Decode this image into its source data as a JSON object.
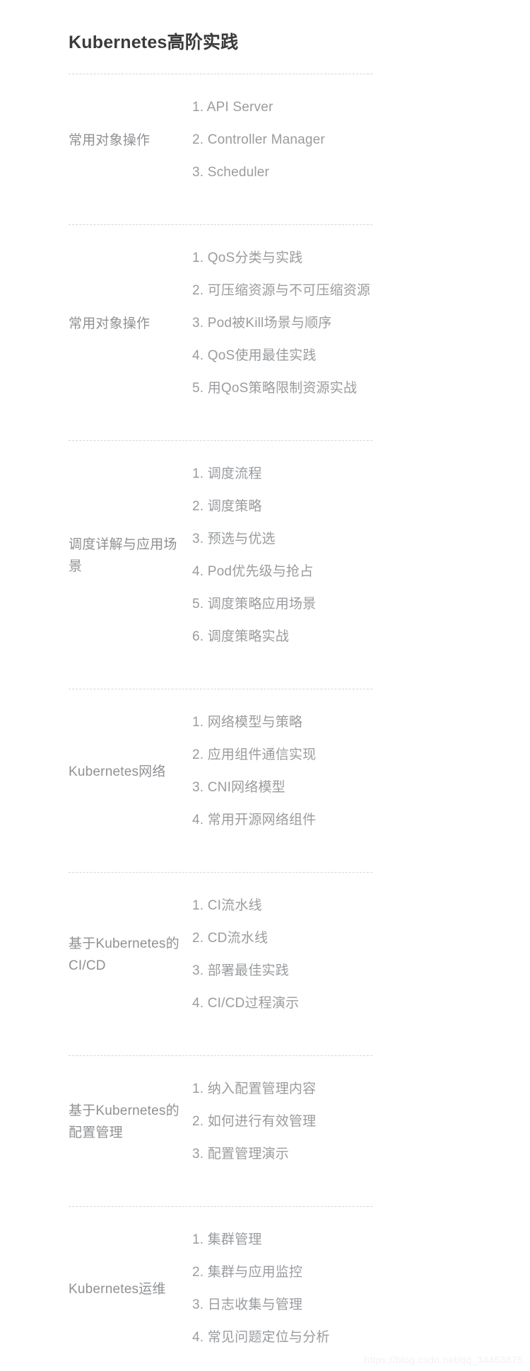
{
  "title": "Kubernetes高阶实践",
  "watermark": "https://blog.csdn.net/qq_34463875",
  "colors": {
    "title": "#3b3b3b",
    "label": "#8f9194",
    "item": "#9a9c9f",
    "divider": "#d6d6d6",
    "watermark": "#f2f2f2",
    "background": "#ffffff"
  },
  "sections": [
    {
      "label": "常用对象操作",
      "items": [
        "1. API Server",
        "2. Controller Manager",
        "3. Scheduler"
      ]
    },
    {
      "label": "常用对象操作",
      "items": [
        "1. QoS分类与实践",
        "2. 可压缩资源与不可压缩资源",
        "3. Pod被Kill场景与顺序",
        "4. QoS使用最佳实践",
        "5. 用QoS策略限制资源实战"
      ]
    },
    {
      "label": "调度详解与应用场景",
      "items": [
        "1. 调度流程",
        "2. 调度策略",
        "3. 预选与优选",
        "4. Pod优先级与抢占",
        "5. 调度策略应用场景",
        "6. 调度策略实战"
      ]
    },
    {
      "label": "Kubernetes网络",
      "items": [
        "1. 网络模型与策略",
        "2. 应用组件通信实现",
        "3. CNI网络模型",
        "4. 常用开源网络组件"
      ]
    },
    {
      "label": "基于Kubernetes的CI/CD",
      "items": [
        "1. CI流水线",
        "2. CD流水线",
        "3. 部署最佳实践",
        "4. CI/CD过程演示"
      ]
    },
    {
      "label": "基于Kubernetes的配置管理",
      "items": [
        "1. 纳入配置管理内容",
        "2. 如何进行有效管理",
        "3. 配置管理演示"
      ]
    },
    {
      "label": "Kubernetes运维",
      "items": [
        "1. 集群管理",
        "2. 集群与应用监控",
        "3. 日志收集与管理",
        "4. 常见问题定位与分析"
      ]
    }
  ]
}
